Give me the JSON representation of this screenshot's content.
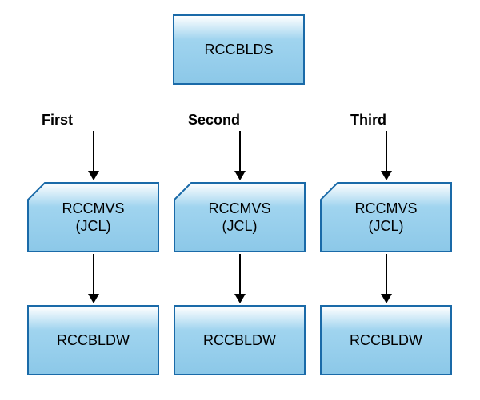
{
  "top": {
    "label": "RCCBLDS"
  },
  "columns": [
    {
      "heading": "First",
      "card_line1": "RCCMVS",
      "card_line2": "(JCL)",
      "bottom": "RCCBLDW"
    },
    {
      "heading": "Second",
      "card_line1": "RCCMVS",
      "card_line2": "(JCL)",
      "bottom": "RCCBLDW"
    },
    {
      "heading": "Third",
      "card_line1": "RCCMVS",
      "card_line2": "(JCL)",
      "bottom": "RCCBLDW"
    }
  ]
}
